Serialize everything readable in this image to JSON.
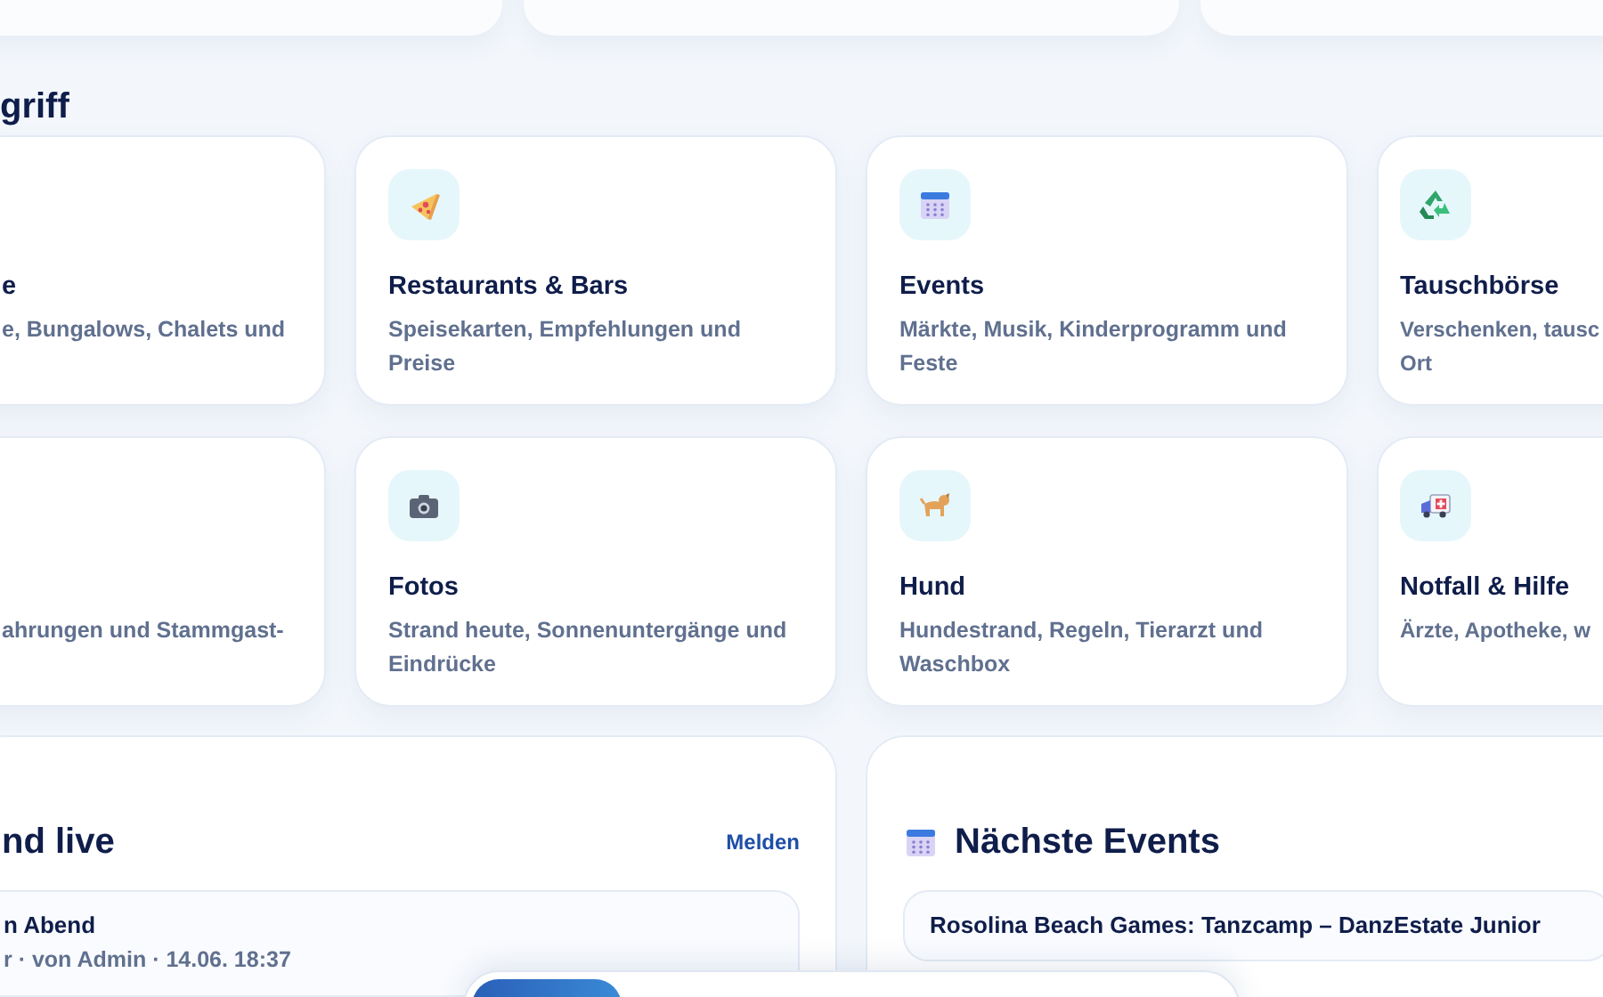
{
  "quick_access": {
    "heading": "griff",
    "tiles": [
      {
        "kind": "none",
        "title": "e",
        "description": [
          "e, Bungalows, Chalets und"
        ]
      },
      {
        "kind": "pizza",
        "title": "Restaurants & Bars",
        "description": [
          "Speisekarten, Empfehlungen und",
          "Preise"
        ]
      },
      {
        "kind": "calendar",
        "title": "Events",
        "description": [
          "Märkte, Musik, Kinderprogramm und",
          "Feste"
        ]
      },
      {
        "kind": "recycle",
        "title": "Tauschbörse",
        "description": [
          "Verschenken, tausc",
          "Ort"
        ]
      },
      {
        "kind": "none",
        "description": [
          "ahrungen und Stammgast-"
        ]
      },
      {
        "kind": "camera",
        "title": "Fotos",
        "description": [
          "Strand heute, Sonnenuntergänge und",
          "Eindrücke"
        ]
      },
      {
        "kind": "dog",
        "title": "Hund",
        "description": [
          "Hundestrand, Regeln, Tierarzt und",
          "Waschbox"
        ]
      },
      {
        "kind": "ambulance",
        "title": "Notfall & Hilfe",
        "description": [
          "Ärzte, Apotheke, w"
        ]
      }
    ]
  },
  "live_panel": {
    "title": "nd live",
    "action": "Melden",
    "items": [
      {
        "title": "n Abend",
        "meta": "r · von Admin · 14.06. 18:37"
      }
    ]
  },
  "events_panel": {
    "title": "Nächste Events",
    "items": [
      {
        "title": "Rosolina Beach Games: Tanzcamp – DanzEstate Junior"
      }
    ]
  }
}
